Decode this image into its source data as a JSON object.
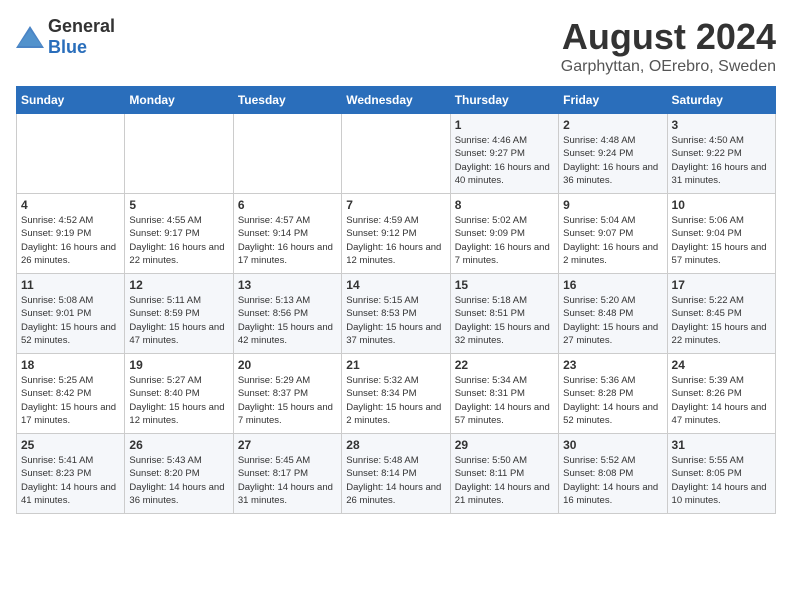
{
  "header": {
    "logo_general": "General",
    "logo_blue": "Blue",
    "main_title": "August 2024",
    "subtitle": "Garphyttan, OErebro, Sweden"
  },
  "calendar": {
    "days_of_week": [
      "Sunday",
      "Monday",
      "Tuesday",
      "Wednesday",
      "Thursday",
      "Friday",
      "Saturday"
    ],
    "weeks": [
      [
        {
          "day": "",
          "info": ""
        },
        {
          "day": "",
          "info": ""
        },
        {
          "day": "",
          "info": ""
        },
        {
          "day": "",
          "info": ""
        },
        {
          "day": "1",
          "info": "Sunrise: 4:46 AM\nSunset: 9:27 PM\nDaylight: 16 hours\nand 40 minutes."
        },
        {
          "day": "2",
          "info": "Sunrise: 4:48 AM\nSunset: 9:24 PM\nDaylight: 16 hours\nand 36 minutes."
        },
        {
          "day": "3",
          "info": "Sunrise: 4:50 AM\nSunset: 9:22 PM\nDaylight: 16 hours\nand 31 minutes."
        }
      ],
      [
        {
          "day": "4",
          "info": "Sunrise: 4:52 AM\nSunset: 9:19 PM\nDaylight: 16 hours\nand 26 minutes."
        },
        {
          "day": "5",
          "info": "Sunrise: 4:55 AM\nSunset: 9:17 PM\nDaylight: 16 hours\nand 22 minutes."
        },
        {
          "day": "6",
          "info": "Sunrise: 4:57 AM\nSunset: 9:14 PM\nDaylight: 16 hours\nand 17 minutes."
        },
        {
          "day": "7",
          "info": "Sunrise: 4:59 AM\nSunset: 9:12 PM\nDaylight: 16 hours\nand 12 minutes."
        },
        {
          "day": "8",
          "info": "Sunrise: 5:02 AM\nSunset: 9:09 PM\nDaylight: 16 hours\nand 7 minutes."
        },
        {
          "day": "9",
          "info": "Sunrise: 5:04 AM\nSunset: 9:07 PM\nDaylight: 16 hours\nand 2 minutes."
        },
        {
          "day": "10",
          "info": "Sunrise: 5:06 AM\nSunset: 9:04 PM\nDaylight: 15 hours\nand 57 minutes."
        }
      ],
      [
        {
          "day": "11",
          "info": "Sunrise: 5:08 AM\nSunset: 9:01 PM\nDaylight: 15 hours\nand 52 minutes."
        },
        {
          "day": "12",
          "info": "Sunrise: 5:11 AM\nSunset: 8:59 PM\nDaylight: 15 hours\nand 47 minutes."
        },
        {
          "day": "13",
          "info": "Sunrise: 5:13 AM\nSunset: 8:56 PM\nDaylight: 15 hours\nand 42 minutes."
        },
        {
          "day": "14",
          "info": "Sunrise: 5:15 AM\nSunset: 8:53 PM\nDaylight: 15 hours\nand 37 minutes."
        },
        {
          "day": "15",
          "info": "Sunrise: 5:18 AM\nSunset: 8:51 PM\nDaylight: 15 hours\nand 32 minutes."
        },
        {
          "day": "16",
          "info": "Sunrise: 5:20 AM\nSunset: 8:48 PM\nDaylight: 15 hours\nand 27 minutes."
        },
        {
          "day": "17",
          "info": "Sunrise: 5:22 AM\nSunset: 8:45 PM\nDaylight: 15 hours\nand 22 minutes."
        }
      ],
      [
        {
          "day": "18",
          "info": "Sunrise: 5:25 AM\nSunset: 8:42 PM\nDaylight: 15 hours\nand 17 minutes."
        },
        {
          "day": "19",
          "info": "Sunrise: 5:27 AM\nSunset: 8:40 PM\nDaylight: 15 hours\nand 12 minutes."
        },
        {
          "day": "20",
          "info": "Sunrise: 5:29 AM\nSunset: 8:37 PM\nDaylight: 15 hours\nand 7 minutes."
        },
        {
          "day": "21",
          "info": "Sunrise: 5:32 AM\nSunset: 8:34 PM\nDaylight: 15 hours\nand 2 minutes."
        },
        {
          "day": "22",
          "info": "Sunrise: 5:34 AM\nSunset: 8:31 PM\nDaylight: 14 hours\nand 57 minutes."
        },
        {
          "day": "23",
          "info": "Sunrise: 5:36 AM\nSunset: 8:28 PM\nDaylight: 14 hours\nand 52 minutes."
        },
        {
          "day": "24",
          "info": "Sunrise: 5:39 AM\nSunset: 8:26 PM\nDaylight: 14 hours\nand 47 minutes."
        }
      ],
      [
        {
          "day": "25",
          "info": "Sunrise: 5:41 AM\nSunset: 8:23 PM\nDaylight: 14 hours\nand 41 minutes."
        },
        {
          "day": "26",
          "info": "Sunrise: 5:43 AM\nSunset: 8:20 PM\nDaylight: 14 hours\nand 36 minutes."
        },
        {
          "day": "27",
          "info": "Sunrise: 5:45 AM\nSunset: 8:17 PM\nDaylight: 14 hours\nand 31 minutes."
        },
        {
          "day": "28",
          "info": "Sunrise: 5:48 AM\nSunset: 8:14 PM\nDaylight: 14 hours\nand 26 minutes."
        },
        {
          "day": "29",
          "info": "Sunrise: 5:50 AM\nSunset: 8:11 PM\nDaylight: 14 hours\nand 21 minutes."
        },
        {
          "day": "30",
          "info": "Sunrise: 5:52 AM\nSunset: 8:08 PM\nDaylight: 14 hours\nand 16 minutes."
        },
        {
          "day": "31",
          "info": "Sunrise: 5:55 AM\nSunset: 8:05 PM\nDaylight: 14 hours\nand 10 minutes."
        }
      ]
    ]
  }
}
